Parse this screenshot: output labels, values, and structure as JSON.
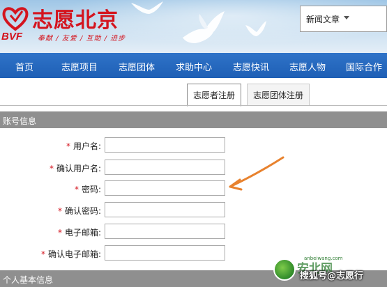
{
  "header": {
    "logo_title": "志愿北京",
    "logo_en": "BVF",
    "logo_slogan": "奉献 / 友爱 / 互助 / 进步",
    "search_select": "新闻文章"
  },
  "nav": {
    "items": [
      "首页",
      "志愿项目",
      "志愿团体",
      "求助中心",
      "志愿快讯",
      "志愿人物",
      "国际合作"
    ]
  },
  "tabs": [
    {
      "label": "志愿者注册",
      "active": true
    },
    {
      "label": "志愿团体注册",
      "active": false
    }
  ],
  "sections": {
    "account": "账号信息",
    "personal": "个人基本信息"
  },
  "form": {
    "required_mark": "*",
    "fields": [
      {
        "label": "用户名:",
        "value": ""
      },
      {
        "label": "确认用户名:",
        "value": ""
      },
      {
        "label": "密码:",
        "value": ""
      },
      {
        "label": "确认密码:",
        "value": ""
      },
      {
        "label": "电子邮箱:",
        "value": ""
      },
      {
        "label": "确认电子邮箱:",
        "value": ""
      }
    ]
  },
  "watermark": {
    "site": "anbeiwang.com",
    "brand": "安北网",
    "text": "搜狐号@志愿行"
  },
  "colors": {
    "brand_red": "#d4141e",
    "nav_blue": "#1e5fb5",
    "section_gray": "#8f8f8f",
    "annotation_arrow": "#e8822e"
  }
}
